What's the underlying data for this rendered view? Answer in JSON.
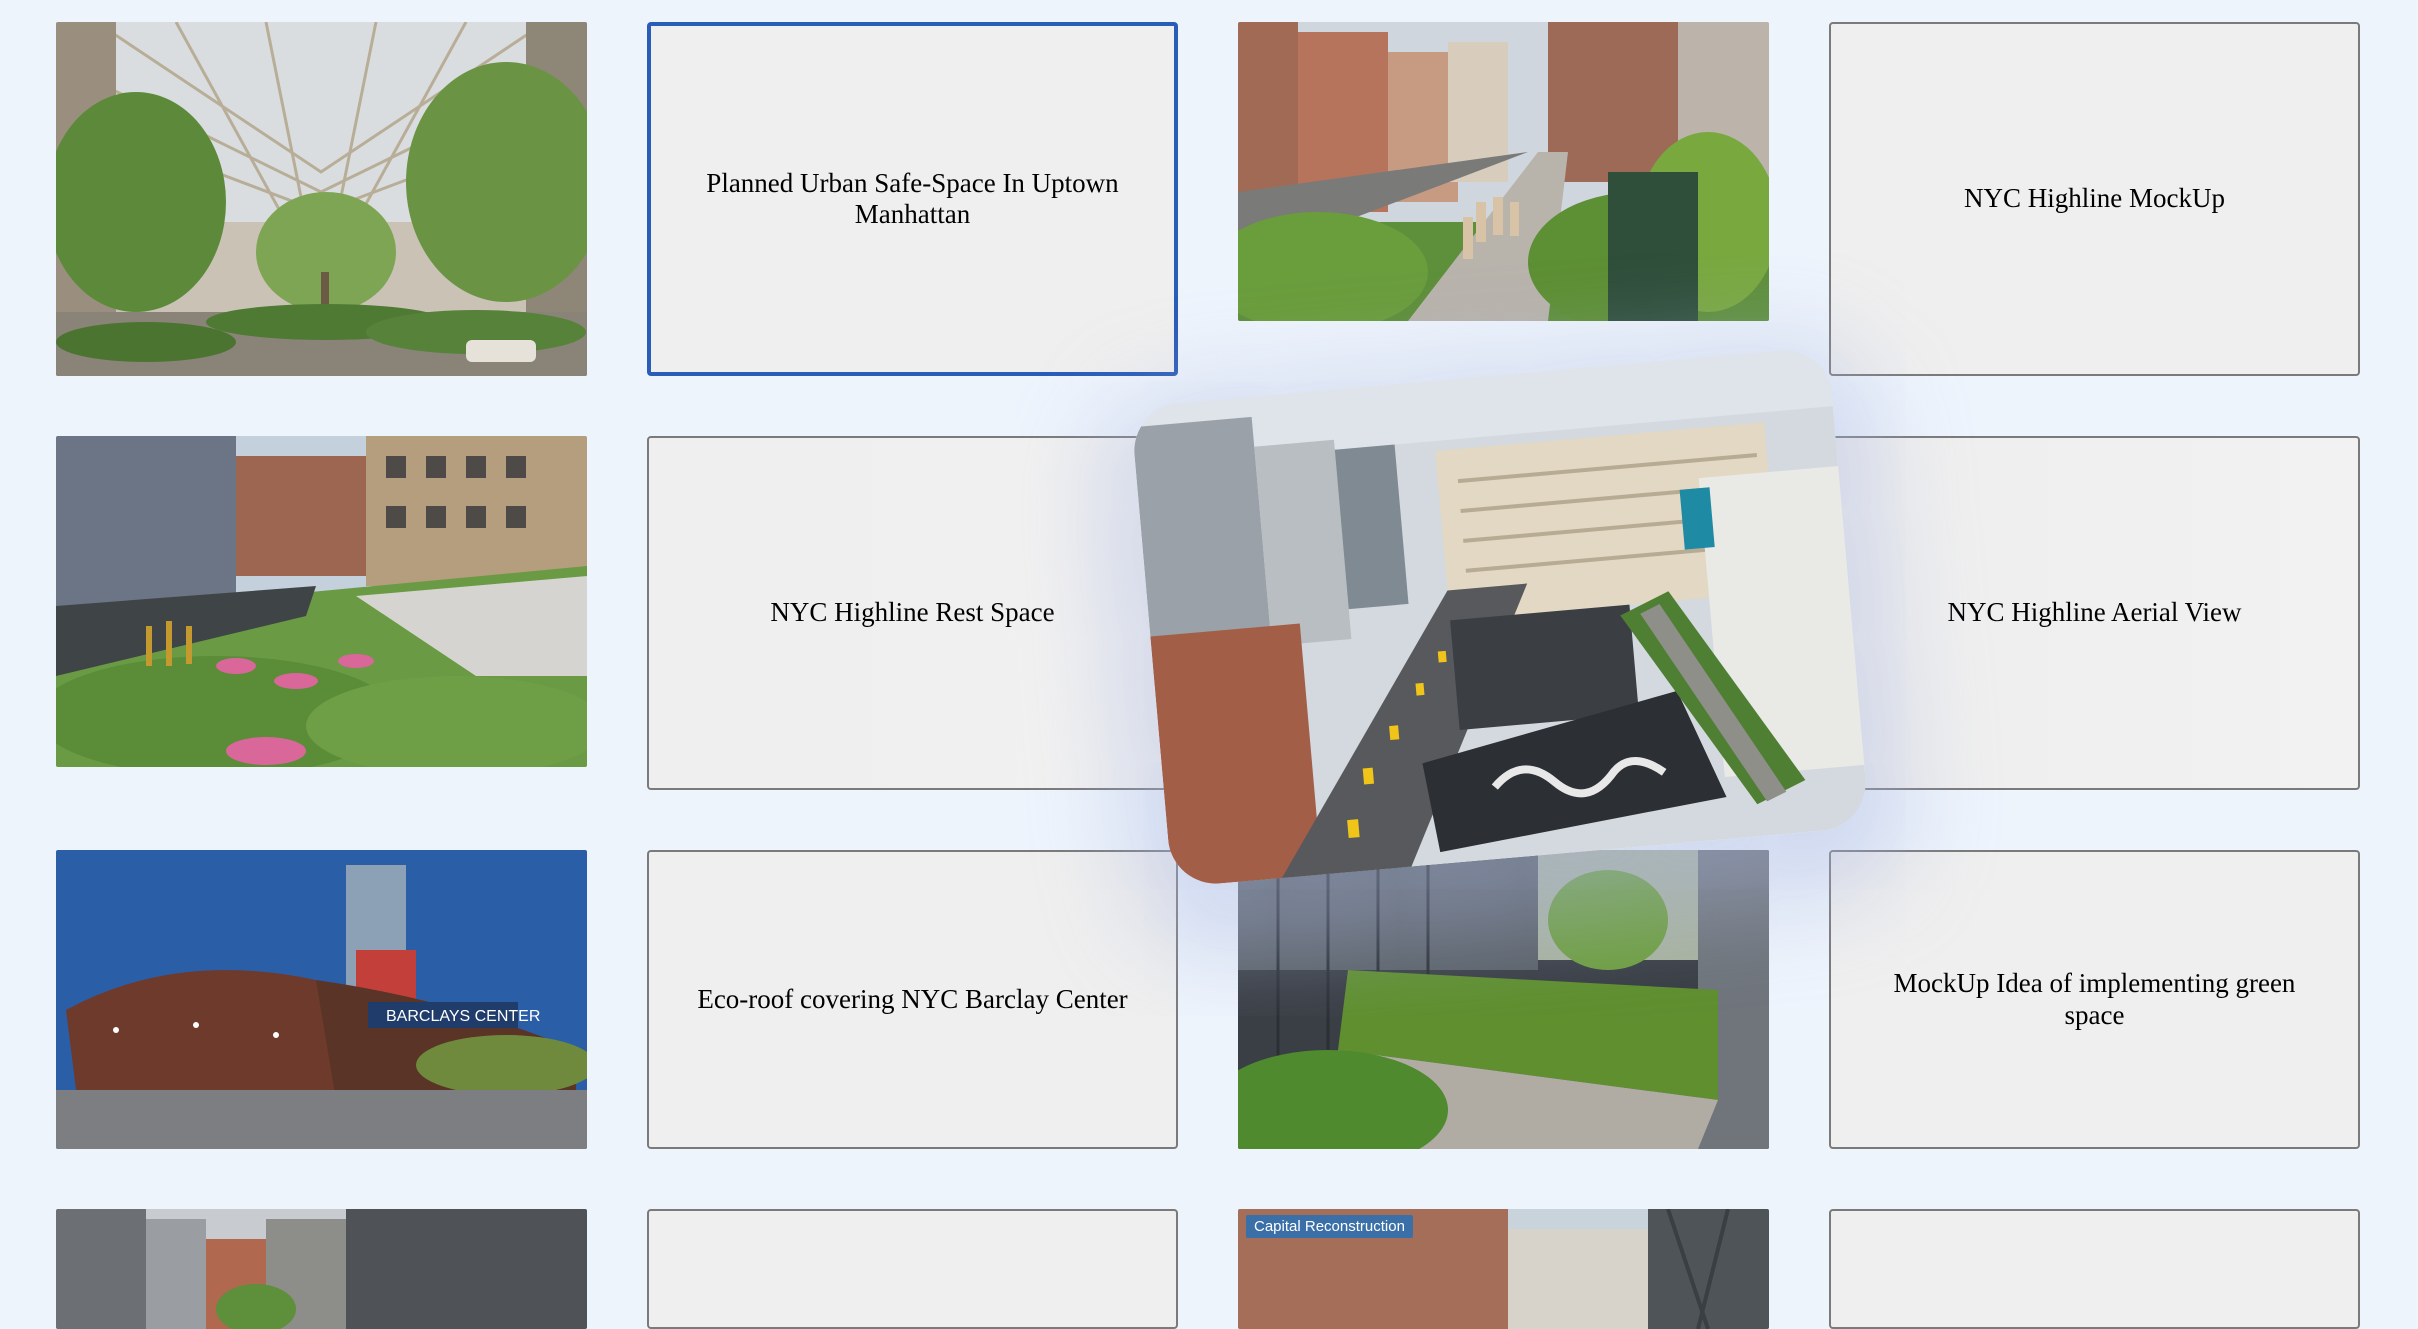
{
  "cards": {
    "r1c2": "Planned Urban Safe-Space In Uptown Manhattan",
    "r1c4": "NYC Highline MockUp",
    "r2c2": "NYC Highline Rest Space",
    "r2c4": "NYC Highline Aerial View",
    "r3c2": "Eco-roof covering NYC Barclay Center",
    "r3c4": "MockUp Idea of implementing green space"
  },
  "photos": {
    "r4c3_label": "Capital Reconstruction",
    "barclays_sign": "BARCLAYS CENTER"
  },
  "colors": {
    "background": "#eef4fc",
    "card_bg": "#efefef",
    "card_border": "#7a7a7a",
    "selected_border": "#2a5db8"
  }
}
